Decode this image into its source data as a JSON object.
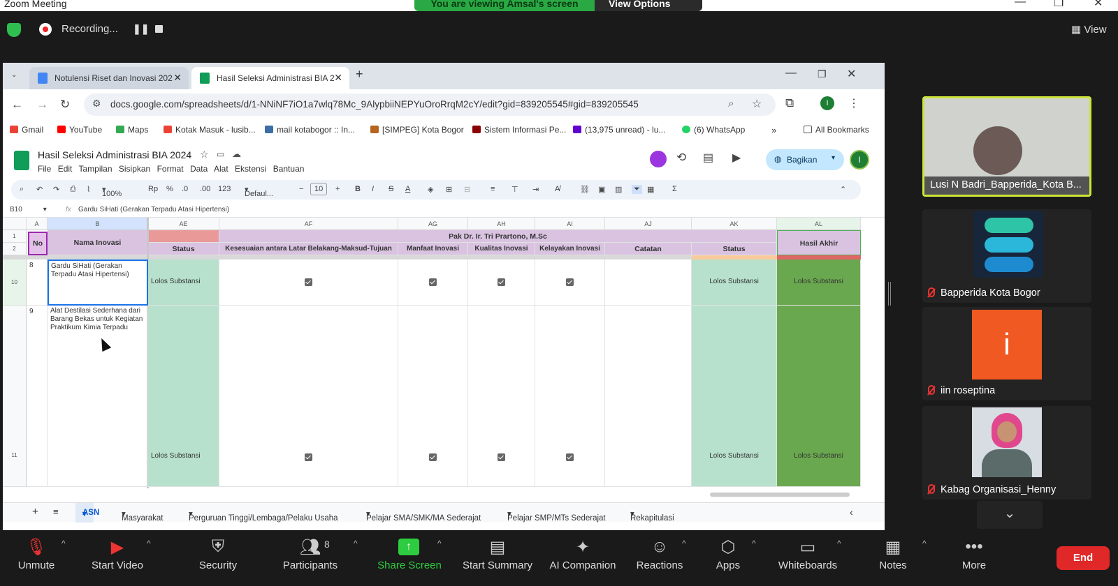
{
  "zoom": {
    "window_title": "Zoom Meeting",
    "viewing_text": "You are viewing Amsal's screen",
    "view_options": "View Options",
    "recording": "Recording...",
    "view": "View",
    "end": "End"
  },
  "browser": {
    "tabs": [
      {
        "label": "Notulensi Riset dan Inovasi 202"
      },
      {
        "label": "Hasil Seleksi Administrasi BIA 2"
      }
    ],
    "url": "docs.google.com/spreadsheets/d/1-NNiNF7iO1a7wlq78Mc_9AlypbiiNEPYuOroRrqM2cY/edit?gid=839205545#gid=839205545",
    "avatar_letter": "I",
    "bookmarks": [
      "Gmail",
      "YouTube",
      "Maps",
      "Kotak Masuk - lusib...",
      "mail kotabogor :: In...",
      "[SIMPEG] Kota Bogor",
      "Sistem Informasi Pe...",
      "(13,975 unread) - lu...",
      "(6) WhatsApp"
    ],
    "all_bookmarks": "All Bookmarks"
  },
  "sheet": {
    "doc_title": "Hasil Seleksi Administrasi BIA 2024",
    "menu": [
      "File",
      "Edit",
      "Tampilan",
      "Sisipkan",
      "Format",
      "Data",
      "Alat",
      "Ekstensi",
      "Bantuan"
    ],
    "share": "Bagikan",
    "zoom": "100%",
    "currency": "Rp",
    "percent": "%",
    "dec_minus": ".0",
    "dec_plus": ".00",
    "num_fmt": "123",
    "font": "Defaul...",
    "font_size": "10",
    "cell_ref": "B10",
    "formula": "Gardu SiHati (Gerakan Terpadu Atasi Hipertensi)",
    "columns": [
      "A",
      "B",
      "AE",
      "AF",
      "AG",
      "AH",
      "AI",
      "AJ",
      "AK",
      "AL"
    ],
    "header": {
      "no": "No",
      "nama": "Nama Inovasi",
      "reviewer": "Pak Dr. Ir. Tri Prartono, M.Sc",
      "status": "Status",
      "kesesuaian": "Kesesuaian antara Latar Belakang-Maksud-Tujuan",
      "manfaat": "Manfaat Inovasi",
      "kualitas": "Kualitas Inovasi",
      "kelayakan": "Kelayakan Inovasi",
      "catatan": "Catatan",
      "status2": "Status",
      "hasil": "Hasil Akhir"
    },
    "rows": [
      {
        "row": "10",
        "no": "8",
        "nama": "Gardu SiHati (Gerakan Terpadu Atasi Hipertensi)",
        "status": "Lolos Substansi",
        "status2": "Lolos Substansi",
        "hasil": "Lolos Substansi"
      },
      {
        "row": "11",
        "no": "9",
        "nama": "Alat Destilasi Sederhana dari Barang Bekas untuk Kegiatan Praktikum Kimia Terpadu",
        "status": "Lolos Substansi",
        "status2": "Lolos Substansi",
        "hasil": "Lolos Substansi"
      }
    ],
    "sheet_tabs": [
      "ASN",
      "Masyarakat",
      "Perguruan Tinggi/Lembaga/Pelaku Usaha",
      "Pelajar SMA/SMK/MA Sederajat",
      "Pelajar SMP/MTs Sederajat",
      "Rekapitulasi"
    ]
  },
  "participants": [
    {
      "name": "Lusi N Badri_Bapperida_Kota B..."
    },
    {
      "name": "Bapperida Kota Bogor"
    },
    {
      "name": "iin roseptina",
      "initial": "i"
    },
    {
      "name": "Kabag Organisasi_Henny"
    }
  ],
  "controls": [
    {
      "label": "Unmute"
    },
    {
      "label": "Start Video"
    },
    {
      "label": "Security"
    },
    {
      "label": "Participants",
      "count": "8"
    },
    {
      "label": "Share Screen"
    },
    {
      "label": "Start Summary"
    },
    {
      "label": "AI Companion"
    },
    {
      "label": "Reactions"
    },
    {
      "label": "Apps"
    },
    {
      "label": "Whiteboards"
    },
    {
      "label": "Notes"
    },
    {
      "label": "More"
    }
  ]
}
